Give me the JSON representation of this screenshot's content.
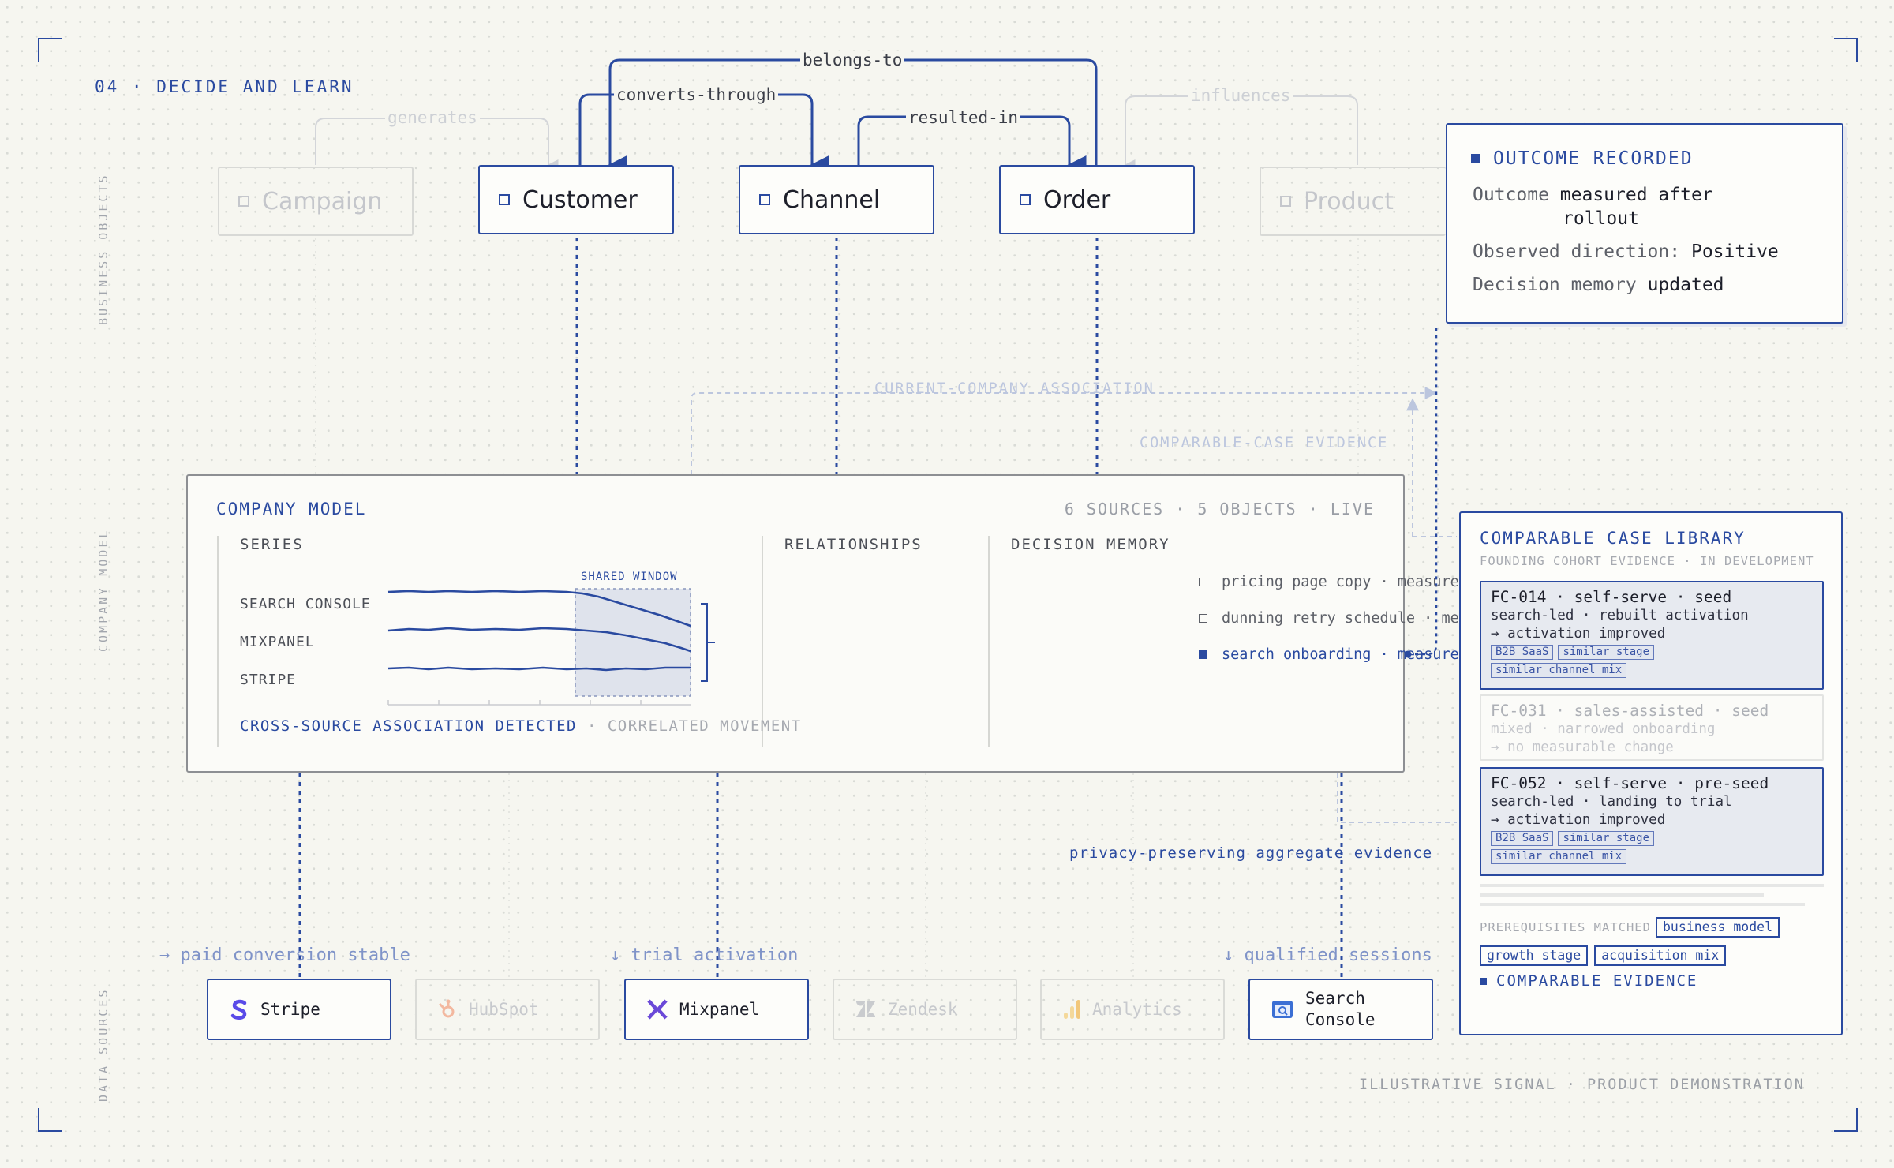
{
  "section": {
    "title": "04 · DECIDE AND LEARN"
  },
  "side_labels": {
    "business": "BUSINESS OBJECTS",
    "model": "COMPANY MODEL",
    "sources": "DATA SOURCES"
  },
  "objects": {
    "campaign": "Campaign",
    "customer": "Customer",
    "channel": "Channel",
    "order": "Order",
    "product": "Product"
  },
  "edges": {
    "belongs_to": "belongs-to",
    "converts_through": "converts-through",
    "resulted_in": "resulted-in",
    "generates": "generates",
    "influences": "influences"
  },
  "outcome": {
    "title": "OUTCOME RECORDED",
    "row1_label": "Outcome",
    "row1_value_a": "measured after",
    "row1_value_b": "rollout",
    "row2_label": "Observed direction:",
    "row2_value": "Positive",
    "row3_label": "Decision memory",
    "row3_value": "updated"
  },
  "flows": {
    "current_company": "CURRENT-COMPANY ASSOCIATION",
    "comparable_case": "COMPARABLE-CASE EVIDENCE",
    "privacy": "privacy-preserving aggregate evidence"
  },
  "model": {
    "title": "COMPANY MODEL",
    "meta": "6 SOURCES · 5 OBJECTS · LIVE",
    "series_header": "SERIES",
    "shared_window": "SHARED WINDOW",
    "series": [
      "SEARCH CONSOLE",
      "MIXPANEL",
      "STRIPE"
    ],
    "assoc_label": "CROSS-SOURCE ASSOCIATION DETECTED",
    "assoc_sub": "· CORRELATED MOVEMENT",
    "relationships_header": "RELATIONSHIPS",
    "decision_header": "DECISION MEMORY",
    "decisions": [
      {
        "label": "pricing page copy · measured",
        "active": false
      },
      {
        "label": "dunning retry schedule · measured",
        "active": false
      },
      {
        "label": "search onboarding · measured",
        "active": true
      }
    ]
  },
  "sources": {
    "stripe": "Stripe",
    "hubspot": "HubSpot",
    "mixpanel": "Mixpanel",
    "zendesk": "Zendesk",
    "analytics": "Analytics",
    "search_console_a": "Search",
    "search_console_b": "Console",
    "note_stripe": "→ paid conversion stable",
    "note_mixpanel": "↓ trial activation",
    "note_search": "↓ qualified sessions"
  },
  "library": {
    "title": "COMPARABLE CASE LIBRARY",
    "subtitle": "FOUNDING COHORT EVIDENCE · IN DEVELOPMENT",
    "cases": [
      {
        "title": "FC-014 · self-serve · seed",
        "line1": "search-led · rebuilt activation",
        "line2": "→ activation improved",
        "tags": [
          "B2B SaaS",
          "similar stage",
          "similar channel mix"
        ]
      },
      {
        "title": "FC-031 · sales-assisted · seed",
        "line1": "mixed · narrowed onboarding",
        "line2": "→ no measurable change",
        "tags": []
      },
      {
        "title": "FC-052 · self-serve · pre-seed",
        "line1": "search-led · landing to trial",
        "line2": "→ activation improved",
        "tags": [
          "B2B SaaS",
          "similar stage",
          "similar channel mix"
        ]
      }
    ],
    "prereq_label": "PREREQUISITES MATCHED",
    "prereqs": [
      "business model",
      "growth stage",
      "acquisition mix"
    ],
    "evidence_label": "COMPARABLE EVIDENCE"
  },
  "footer": "ILLUSTRATIVE SIGNAL · PRODUCT DEMONSTRATION",
  "colors": {
    "accent": "#2a4aa0",
    "background": "#f6f6f0",
    "faded": "#c4c6cb",
    "series_line": "#2a4aa0"
  }
}
